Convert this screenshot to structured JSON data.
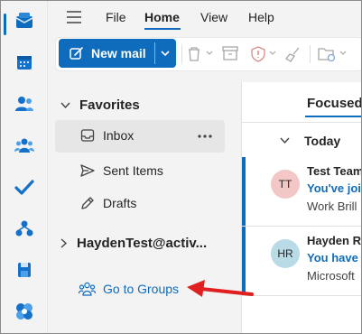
{
  "colors": {
    "accent": "#0f6cbd",
    "annotation": "#e02020"
  },
  "menu": {
    "file": "File",
    "home": "Home",
    "view": "View",
    "help": "Help"
  },
  "toolbar": {
    "new_mail_label": "New mail"
  },
  "rail": {
    "icons": [
      "outlook-mail-icon",
      "calendar-icon",
      "people-icon",
      "groups-icon",
      "todo-check-icon",
      "org-explorer-icon",
      "save-disk-icon",
      "apps-icon"
    ]
  },
  "folders": {
    "favorites_header": "Favorites",
    "items": [
      {
        "label": "Inbox",
        "icon": "inbox-icon"
      },
      {
        "label": "Sent Items",
        "icon": "send-icon"
      },
      {
        "label": "Drafts",
        "icon": "pencil-icon"
      }
    ],
    "account": "HaydenTest@activ...",
    "go_to_groups": "Go to Groups"
  },
  "mail_list": {
    "focused_tab": "Focused",
    "group_header": "Today",
    "messages": [
      {
        "initials": "TT",
        "avatar_color": "#f4c7c7",
        "sender": "Test Team",
        "subject": "You've joi",
        "preview": "Work Brill"
      },
      {
        "initials": "HR",
        "avatar_color": "#b9dbe6",
        "sender": "Hayden R",
        "subject": "You have",
        "preview": "Microsoft"
      }
    ]
  }
}
